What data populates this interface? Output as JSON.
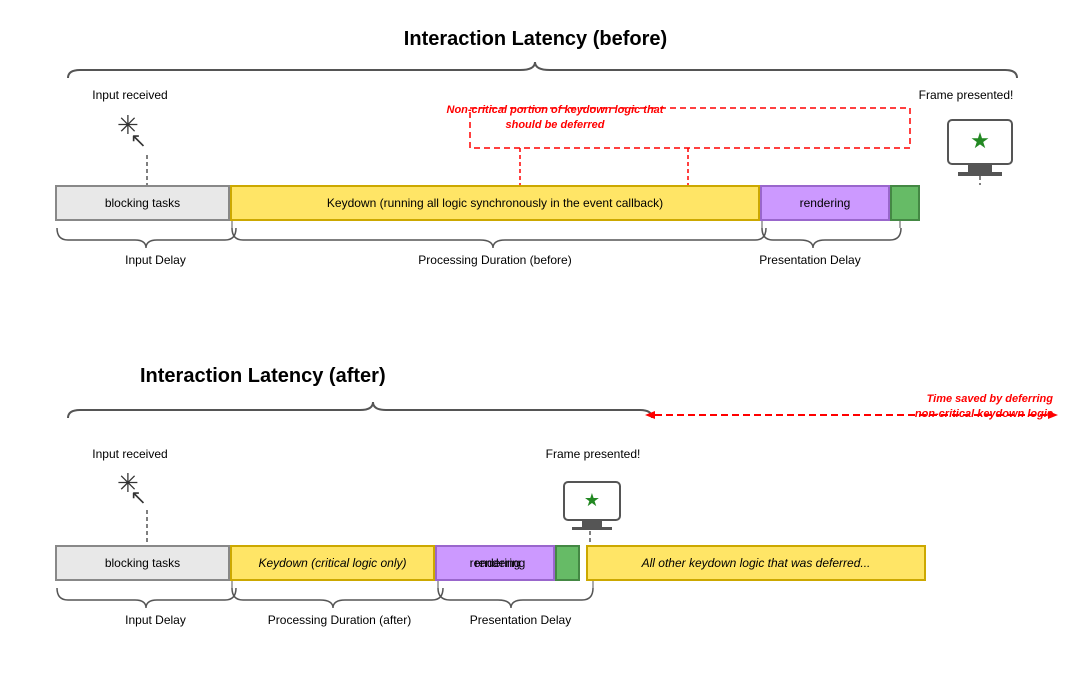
{
  "top": {
    "title": "Interaction Latency (before)",
    "input_received": "Input received",
    "frame_presented": "Frame presented!",
    "red_annotation": "Non-critical portion of keydown logic that should be deferred",
    "bar_blocking": "blocking tasks",
    "bar_keydown": "Keydown (running all logic synchronously in the event callback)",
    "bar_rendering": "rendering",
    "label_input_delay": "Input Delay",
    "label_processing": "Processing Duration (before)",
    "label_presentation": "Presentation Delay"
  },
  "bottom": {
    "title": "Interaction Latency (after)",
    "input_received": "Input received",
    "frame_presented": "Frame presented!",
    "bar_blocking": "blocking tasks",
    "bar_keydown": "Keydown (critical logic only)",
    "bar_rendering": "rendering",
    "bar_deferred": "All other keydown logic that was deferred...",
    "label_input_delay": "Input Delay",
    "label_processing": "Processing Duration (after)",
    "label_presentation": "Presentation Delay",
    "red_arrow_label": "Time saved by deferring\nnon-critical keydown logic"
  }
}
